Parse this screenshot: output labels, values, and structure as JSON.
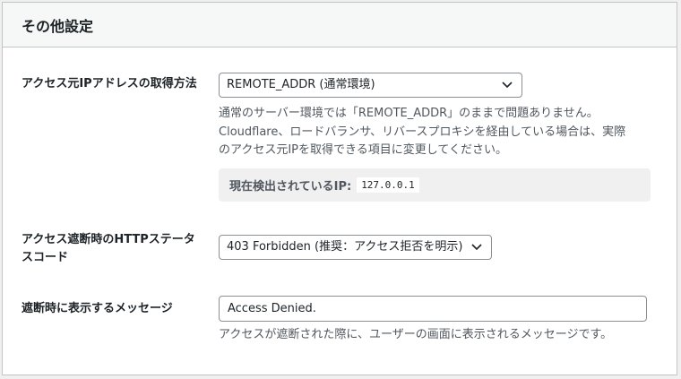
{
  "section": {
    "title": "その他設定"
  },
  "ip_source": {
    "label": "アクセス元IPアドレスの取得方法",
    "selected": "REMOTE_ADDR (通常環境)",
    "description": [
      "通常のサーバー環境では「REMOTE_ADDR」のままで問題ありません。",
      "Cloudflare、ロードバランサ、リバースプロキシを経由している場合は、実際",
      "のアクセス元IPを取得できる項目に変更してください。"
    ],
    "detected_label": "現在検出されているIP:",
    "detected_ip": "127.0.0.1"
  },
  "http_status": {
    "label": "アクセス遮断時のHTTPステータスコード",
    "selected": "403 Forbidden (推奨：アクセス拒否を明示)"
  },
  "block_message": {
    "label": "遮断時に表示するメッセージ",
    "value": "Access Denied.",
    "description": "アクセスが遮断された際に、ユーザーの画面に表示されるメッセージです。"
  },
  "icons": {
    "dropdown": "chevron-down-icon"
  }
}
